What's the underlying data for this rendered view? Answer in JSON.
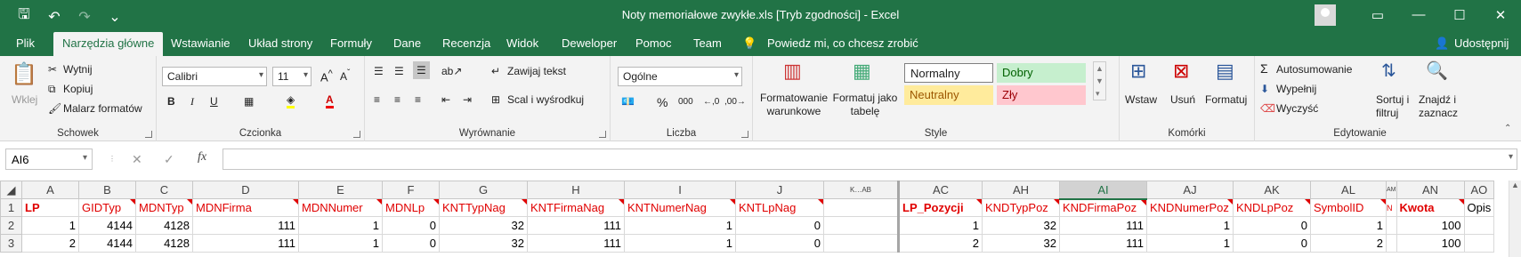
{
  "window": {
    "title": "Noty memoriałowe zwykłe.xls  [Tryb zgodności]  -  Excel",
    "qat": {
      "save": "🖫",
      "undo": "↶",
      "redo": "↷",
      "more": "⌄"
    },
    "controls": {
      "ribbon_display": "▭",
      "minimize": "—",
      "maximize": "☐",
      "close": "✕"
    }
  },
  "menu": {
    "tabs": [
      "Plik",
      "Narzędzia główne",
      "Wstawianie",
      "Układ strony",
      "Formuły",
      "Dane",
      "Recenzja",
      "Widok",
      "Deweloper",
      "Pomoc",
      "Team"
    ],
    "active": "Narzędzia główne",
    "tell_me": "Powiedz mi, co chcesz zrobić",
    "share": "Udostępnij"
  },
  "ribbon": {
    "clipboard": {
      "label": "Schowek",
      "paste": "Wklej",
      "cut": "Wytnij",
      "copy": "Kopiuj",
      "painter": "Malarz formatów"
    },
    "font": {
      "label": "Czcionka",
      "name": "Calibri",
      "size": "11",
      "bold": "B",
      "italic": "I",
      "underline": "U"
    },
    "alignment": {
      "label": "Wyrównanie",
      "wrap": "Zawijaj tekst",
      "merge": "Scal i wyśrodkuj"
    },
    "number": {
      "label": "Liczba",
      "format": "Ogólne",
      "percent": "%",
      "thousands": "000"
    },
    "styles": {
      "label": "Style",
      "conditional": "Formatowanie warunkowe",
      "as_table": "Formatuj jako tabelę",
      "normal": "Normalny",
      "good": "Dobry",
      "neutral": "Neutralny",
      "bad": "Zły"
    },
    "cells": {
      "label": "Komórki",
      "insert": "Wstaw",
      "delete": "Usuń",
      "format": "Formatuj"
    },
    "editing": {
      "label": "Edytowanie",
      "autosum": "Autosumowanie",
      "fill": "Wypełnij",
      "clear": "Wyczyść",
      "sort": "Sortuj i filtruj",
      "find": "Znajdź i zaznacz"
    }
  },
  "formula_bar": {
    "name_box": "AI6",
    "fx": "fx",
    "value": ""
  },
  "colors": {
    "accent": "#217346",
    "header_red": "#e00000"
  },
  "sheet": {
    "columns": [
      "A",
      "B",
      "C",
      "D",
      "E",
      "F",
      "G",
      "H",
      "I",
      "J",
      "K…AB",
      "AC",
      "AH",
      "AI",
      "AJ",
      "AK",
      "AL",
      "AM",
      "AN",
      "AO"
    ],
    "rows": [
      {
        "n": "1",
        "cells": [
          "LP",
          "GIDTyp",
          "MDNTyp",
          "MDNFirma",
          "MDNNumer",
          "MDNLp",
          "KNTTypNag",
          "KNTFirmaNag",
          "KNTNumerNag",
          "KNTLpNag",
          "",
          "LP_Pozycji",
          "KNDTypPoz",
          "KNDFirmaPoz",
          "KNDNumerPoz",
          "KNDLpPoz",
          "SymbolID",
          "N",
          "Kwota",
          "Opis"
        ]
      },
      {
        "n": "2",
        "cells": [
          "1",
          "4144",
          "4128",
          "111",
          "1",
          "0",
          "32",
          "111",
          "1",
          "0",
          "",
          "1",
          "32",
          "111",
          "1",
          "0",
          "1",
          "",
          "100",
          ""
        ]
      },
      {
        "n": "3",
        "cells": [
          "2",
          "4144",
          "4128",
          "111",
          "1",
          "0",
          "32",
          "111",
          "1",
          "0",
          "",
          "2",
          "32",
          "111",
          "1",
          "0",
          "2",
          "",
          "100",
          ""
        ]
      }
    ]
  }
}
